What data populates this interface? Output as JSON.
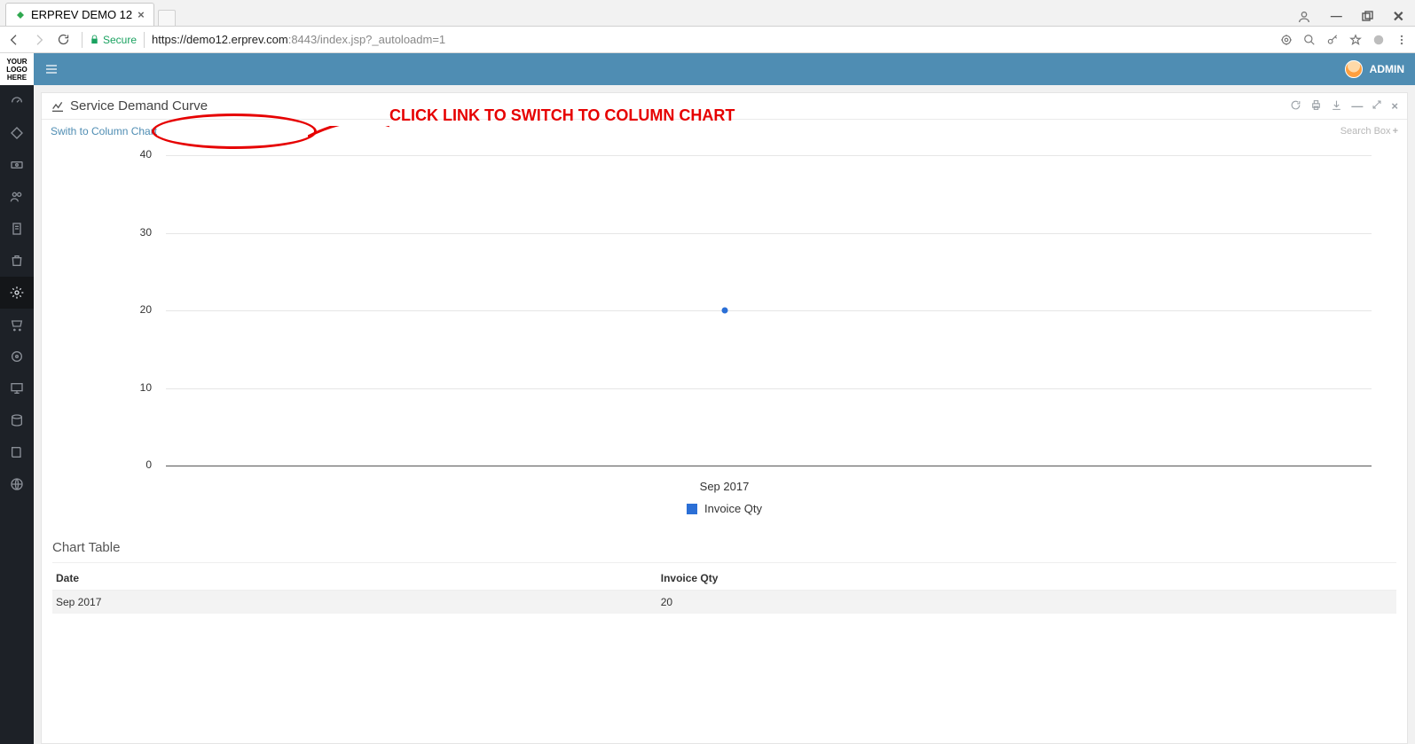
{
  "browser": {
    "tab_title": "ERPREV DEMO 12",
    "secure_label": "Secure",
    "url_host": "https://demo12.erprev.com",
    "url_port": ":8443",
    "url_path": "/index.jsp?_autoloadm=1"
  },
  "header": {
    "logo_text": "YOUR\nLOGO\nHERE",
    "user_label": "ADMIN"
  },
  "panel": {
    "title": "Service Demand Curve",
    "switch_link": "Swith to Column Chart",
    "search_box_label": "Search Box"
  },
  "annotation": {
    "text": "CLICK LINK TO SWITCH TO COLUMN CHART"
  },
  "chart_data": {
    "type": "line",
    "title": "",
    "xlabel": "",
    "ylabel": "",
    "ylim": [
      0,
      40
    ],
    "yticks": [
      0,
      10,
      20,
      30,
      40
    ],
    "categories": [
      "Sep 2017"
    ],
    "series": [
      {
        "name": "Invoice Qty",
        "values": [
          20
        ]
      }
    ]
  },
  "chart_table": {
    "title": "Chart Table",
    "headers": [
      "Date",
      "Invoice Qty"
    ],
    "rows": [
      [
        "Sep 2017",
        "20"
      ]
    ]
  }
}
